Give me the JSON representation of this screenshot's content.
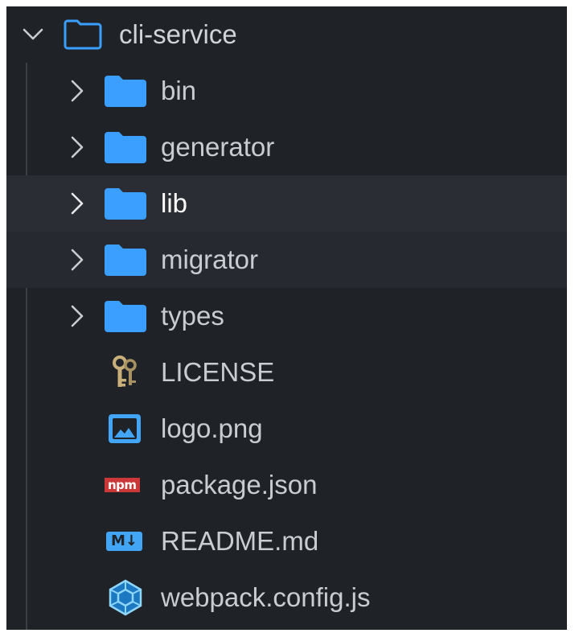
{
  "explorer": {
    "root": {
      "label": "cli-service",
      "icon": "folder-outline-icon",
      "expanded": true
    },
    "items": [
      {
        "label": "bin",
        "type": "folder",
        "icon": "folder-icon"
      },
      {
        "label": "generator",
        "type": "folder",
        "icon": "folder-icon"
      },
      {
        "label": "lib",
        "type": "folder",
        "icon": "folder-icon",
        "state": "hover"
      },
      {
        "label": "migrator",
        "type": "folder",
        "icon": "folder-icon",
        "state": "selected"
      },
      {
        "label": "types",
        "type": "folder",
        "icon": "folder-icon"
      },
      {
        "label": "LICENSE",
        "type": "file",
        "icon": "key-icon"
      },
      {
        "label": "logo.png",
        "type": "file",
        "icon": "image-icon"
      },
      {
        "label": "package.json",
        "type": "file",
        "icon": "npm-icon",
        "icon_text": "npm"
      },
      {
        "label": "README.md",
        "type": "file",
        "icon": "markdown-icon",
        "icon_text": "M↓"
      },
      {
        "label": "webpack.config.js",
        "type": "file",
        "icon": "webpack-icon"
      }
    ]
  },
  "colors": {
    "background": "#1f2227",
    "hover_row": "#2a2d33",
    "folder": "#3b9fff",
    "text": "#c9ccd1",
    "npm": "#cb3837",
    "markdown": "#42a5f5",
    "webpack": "#8ed6fb"
  }
}
